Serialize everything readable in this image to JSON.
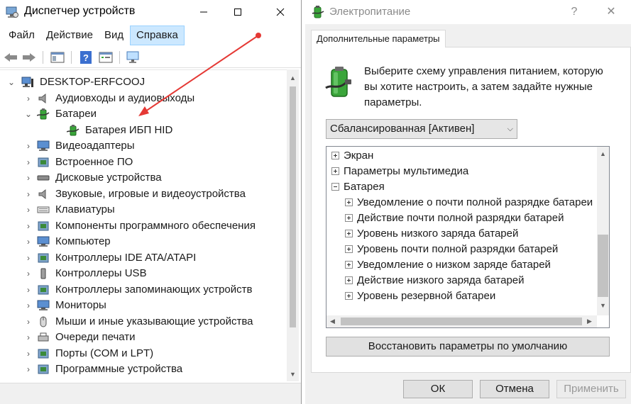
{
  "device_manager": {
    "title": "Диспетчер устройств",
    "menu": [
      "Файл",
      "Действие",
      "Вид",
      "Справка"
    ],
    "active_menu": "Справка",
    "root": "DESKTOP-ERFCOOJ",
    "items": [
      {
        "label": "Аудиовходы и аудиовыходы",
        "icon": "speaker-icon",
        "expander": "›",
        "level": 1
      },
      {
        "label": "Батареи",
        "icon": "battery-icon",
        "expander": "⌄",
        "level": 1
      },
      {
        "label": "Батарея ИБП HID",
        "icon": "battery-icon",
        "expander": "",
        "level": 2
      },
      {
        "label": "Видеоадаптеры",
        "icon": "display-adapter-icon",
        "expander": "›",
        "level": 1
      },
      {
        "label": "Встроенное ПО",
        "icon": "firmware-icon",
        "expander": "›",
        "level": 1
      },
      {
        "label": "Дисковые устройства",
        "icon": "disk-icon",
        "expander": "›",
        "level": 1
      },
      {
        "label": "Звуковые, игровые и видеоустройства",
        "icon": "sound-icon",
        "expander": "›",
        "level": 1
      },
      {
        "label": "Клавиатуры",
        "icon": "keyboard-icon",
        "expander": "›",
        "level": 1
      },
      {
        "label": "Компоненты программного обеспечения",
        "icon": "software-component-icon",
        "expander": "›",
        "level": 1
      },
      {
        "label": "Компьютер",
        "icon": "computer-icon",
        "expander": "›",
        "level": 1
      },
      {
        "label": "Контроллеры IDE ATA/ATAPI",
        "icon": "ide-controller-icon",
        "expander": "›",
        "level": 1
      },
      {
        "label": "Контроллеры USB",
        "icon": "usb-icon",
        "expander": "›",
        "level": 1
      },
      {
        "label": "Контроллеры запоминающих устройств",
        "icon": "storage-controller-icon",
        "expander": "›",
        "level": 1
      },
      {
        "label": "Мониторы",
        "icon": "monitor-icon",
        "expander": "›",
        "level": 1
      },
      {
        "label": "Мыши и иные указывающие устройства",
        "icon": "mouse-icon",
        "expander": "›",
        "level": 1
      },
      {
        "label": "Очереди печати",
        "icon": "printer-icon",
        "expander": "›",
        "level": 1
      },
      {
        "label": "Порты (COM и LPT)",
        "icon": "port-icon",
        "expander": "›",
        "level": 1
      },
      {
        "label": "Программные устройства",
        "icon": "software-device-icon",
        "expander": "›",
        "level": 1
      }
    ]
  },
  "power_options": {
    "title": "Электропитание",
    "help": "?",
    "close": "✕",
    "tab": "Дополнительные параметры",
    "description": "Выберите схему управления питанием, которую вы хотите настроить, а затем задайте нужные параметры.",
    "plan_select": "Сбалансированная [Активен]",
    "tree": [
      {
        "label": "Экран",
        "box": "plus",
        "level": 0
      },
      {
        "label": "Параметры мультимедиа",
        "box": "plus",
        "level": 0
      },
      {
        "label": "Батарея",
        "box": "minus",
        "level": 0
      },
      {
        "label": "Уведомление о почти полной разрядке батареи",
        "box": "plus",
        "level": 1
      },
      {
        "label": "Действие почти полной разрядки батарей",
        "box": "plus",
        "level": 1
      },
      {
        "label": "Уровень низкого заряда батарей",
        "box": "plus",
        "level": 1
      },
      {
        "label": "Уровень почти полной разрядки батарей",
        "box": "plus",
        "level": 1
      },
      {
        "label": "Уведомление о низком заряде батарей",
        "box": "plus",
        "level": 1
      },
      {
        "label": "Действие низкого заряда батарей",
        "box": "plus",
        "level": 1
      },
      {
        "label": "Уровень резервной батареи",
        "box": "plus",
        "level": 1
      }
    ],
    "restore_button": "Восстановить параметры по умолчанию",
    "ok": "ОК",
    "cancel": "Отмена",
    "apply": "Применить"
  },
  "colors": {
    "accent_selection": "#cce8ff",
    "annotation_arrow": "#e53935",
    "battery_green": "#3aa53a"
  }
}
